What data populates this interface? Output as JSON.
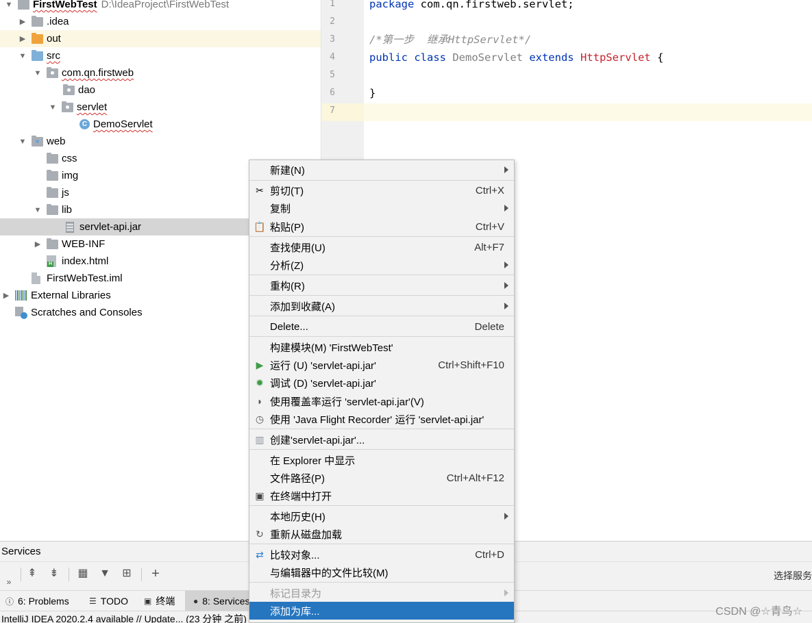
{
  "project_tree": {
    "root": {
      "name": "FirstWebTest",
      "path": "D:\\IdeaProject\\FirstWebTest"
    },
    "items": [
      {
        "label": ".idea"
      },
      {
        "label": "out"
      },
      {
        "label": "src"
      },
      {
        "label": "com.qn.firstweb"
      },
      {
        "label": "dao"
      },
      {
        "label": "servlet"
      },
      {
        "label": "DemoServlet"
      },
      {
        "label": "web"
      },
      {
        "label": "css"
      },
      {
        "label": "img"
      },
      {
        "label": "js"
      },
      {
        "label": "lib"
      },
      {
        "label": "servlet-api.jar"
      },
      {
        "label": "WEB-INF"
      },
      {
        "label": "index.html"
      },
      {
        "label": "FirstWebTest.iml"
      },
      {
        "label": "External Libraries"
      },
      {
        "label": "Scratches and Consoles"
      }
    ]
  },
  "editor": {
    "line_numbers": [
      "1",
      "2",
      "3",
      "4",
      "5",
      "6",
      "7"
    ],
    "code": {
      "line1_kw": "package",
      "line1_rest": " com.qn.firstweb.servlet;",
      "line3_comment_a": "/*",
      "line3_comment_b": "第一步  继承",
      "line3_comment_c": "HttpServlet*/",
      "line4_public": "public",
      "line4_class": " class ",
      "line4_name": "DemoServlet",
      "line4_extends": " extends ",
      "line4_super": "HttpServlet",
      "line4_brace": " {",
      "line6": "}"
    }
  },
  "context_menu": {
    "items": [
      {
        "label": "新建(N)",
        "shortcut": ""
      },
      {
        "label": "剪切(T)",
        "shortcut": "Ctrl+X"
      },
      {
        "label": "复制",
        "shortcut": ""
      },
      {
        "label": "粘贴(P)",
        "shortcut": "Ctrl+V"
      },
      {
        "label": "查找使用(U)",
        "shortcut": "Alt+F7"
      },
      {
        "label": "分析(Z)",
        "shortcut": ""
      },
      {
        "label": "重构(R)",
        "shortcut": ""
      },
      {
        "label": "添加到收藏(A)",
        "shortcut": ""
      },
      {
        "label": "Delete...",
        "shortcut": "Delete"
      },
      {
        "label": "构建模块(M) 'FirstWebTest'",
        "shortcut": ""
      },
      {
        "label": "运行 (U) 'servlet-api.jar'",
        "shortcut": "Ctrl+Shift+F10"
      },
      {
        "label": "调试 (D) 'servlet-api.jar'",
        "shortcut": ""
      },
      {
        "label": "使用覆盖率运行  'servlet-api.jar'(V)",
        "shortcut": ""
      },
      {
        "label": "使用 'Java Flight Recorder' 运行 'servlet-api.jar'",
        "shortcut": ""
      },
      {
        "label": "创建'servlet-api.jar'...",
        "shortcut": ""
      },
      {
        "label": "在 Explorer 中显示",
        "shortcut": ""
      },
      {
        "label": "文件路径(P)",
        "shortcut": "Ctrl+Alt+F12"
      },
      {
        "label": "在终端中打开",
        "shortcut": ""
      },
      {
        "label": "本地历史(H)",
        "shortcut": ""
      },
      {
        "label": "重新从磁盘加载",
        "shortcut": ""
      },
      {
        "label": "比较对象...",
        "shortcut": "Ctrl+D"
      },
      {
        "label": "与编辑器中的文件比较(M)",
        "shortcut": ""
      },
      {
        "label": "标记目录为",
        "shortcut": ""
      },
      {
        "label": "添加为库...",
        "shortcut": ""
      }
    ]
  },
  "services": {
    "title": "Services",
    "right_text": "选择服务",
    "expand_label": "»"
  },
  "tool_tabs": [
    {
      "label": "6: Problems"
    },
    {
      "label": "TODO"
    },
    {
      "label": "终端"
    },
    {
      "label": "8: Services"
    }
  ],
  "status_bar": {
    "text": "IntelliJ IDEA 2020.2.4 available // Update... (23 分钟 之前)"
  },
  "watermark": "CSDN @☆青鸟☆",
  "colors": {
    "menu_active": "#2675bf",
    "keyword": "#0033b3",
    "comment": "#8c8c8c",
    "superclass": "#c7222d",
    "tree_selection": "#d5d5d5"
  }
}
